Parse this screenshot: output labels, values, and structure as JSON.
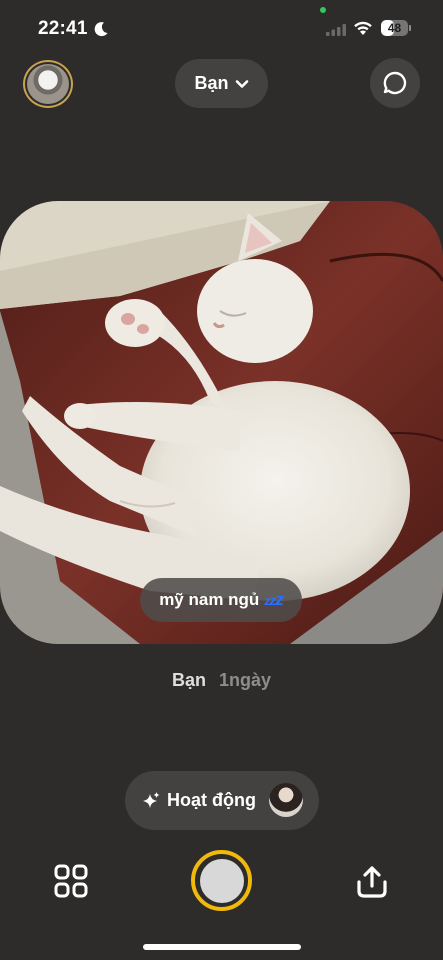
{
  "status_bar": {
    "time": "22:41",
    "battery_level": "48",
    "moon_icon": "moon-icon",
    "signal_icon": "cellular-signal-icon",
    "wifi_icon": "wifi-icon"
  },
  "header": {
    "avatar_icon": "profile-avatar",
    "audience_label": "Bạn",
    "chevron_icon": "chevron-down-icon",
    "chat_icon": "chat-bubble-icon"
  },
  "post": {
    "caption": "mỹ nam ngủ",
    "caption_emoji": "zzz-icon",
    "author": "Bạn",
    "time_ago": "1ngày"
  },
  "activity": {
    "label": "Hoạt động",
    "icon": "sparkle-icon"
  },
  "bottom_bar": {
    "grid_icon": "grid-icon",
    "shutter_icon": "shutter-button",
    "share_icon": "share-icon",
    "shutter_ring_color": "#f0b90b"
  }
}
